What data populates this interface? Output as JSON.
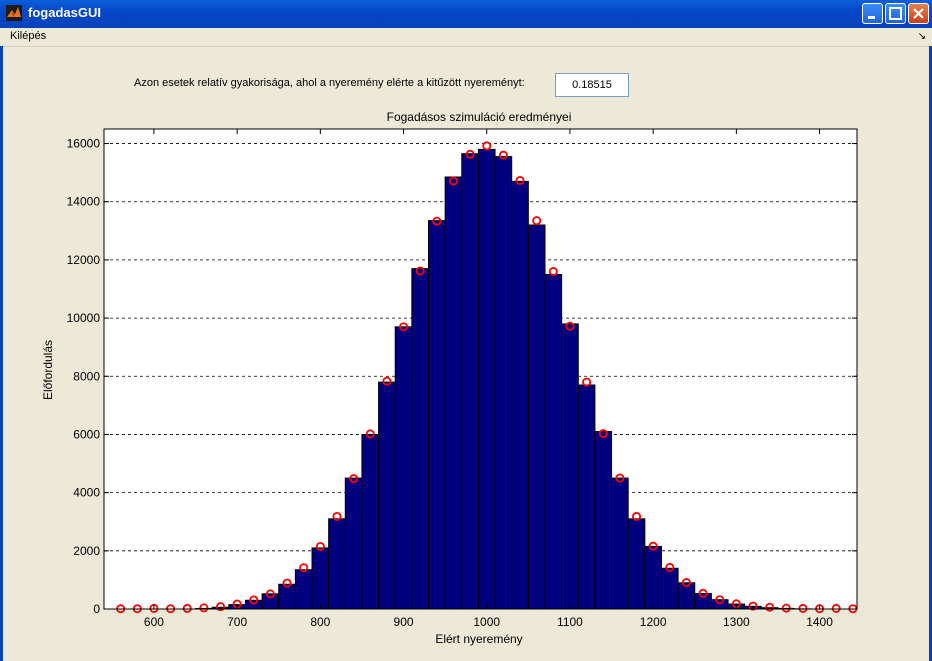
{
  "window": {
    "title": "fogadasGUI"
  },
  "menu": {
    "items": [
      "Kilépés"
    ]
  },
  "panel": {
    "label": "Azon esetek relatív gyakorisága, ahol a nyeremény elérte a kitűzött nyereményt:",
    "value": "0.18515"
  },
  "colors": {
    "bar_fill": "#00007f",
    "marker": "#ff0000",
    "background": "#ece9d8"
  },
  "chart_data": {
    "type": "bar",
    "title": "Fogadásos szimuláció eredményei",
    "xlabel": "Elért nyeremény",
    "ylabel": "Előfordulás",
    "xlim": [
      540,
      1445
    ],
    "ylim": [
      0,
      16500
    ],
    "grid": true,
    "x_ticks": [
      600,
      700,
      800,
      900,
      1000,
      1100,
      1200,
      1300,
      1400
    ],
    "y_ticks": [
      0,
      2000,
      4000,
      6000,
      8000,
      10000,
      12000,
      14000,
      16000
    ],
    "bar_width": 20,
    "x": [
      560,
      580,
      600,
      620,
      640,
      660,
      680,
      700,
      720,
      740,
      760,
      780,
      800,
      820,
      840,
      860,
      880,
      900,
      920,
      940,
      960,
      980,
      1000,
      1020,
      1040,
      1060,
      1080,
      1100,
      1120,
      1140,
      1160,
      1180,
      1200,
      1220,
      1240,
      1260,
      1280,
      1300,
      1320,
      1340,
      1360,
      1380,
      1400,
      1420,
      1440
    ],
    "series": [
      {
        "kind": "bar",
        "values": [
          0,
          0,
          0,
          0,
          0,
          20,
          60,
          150,
          300,
          520,
          850,
          1350,
          2100,
          3100,
          4500,
          6000,
          7800,
          9700,
          11700,
          13350,
          14850,
          15650,
          15800,
          15550,
          14700,
          13200,
          11500,
          9800,
          7700,
          6100,
          4500,
          3100,
          2150,
          1400,
          900,
          530,
          320,
          170,
          90,
          45,
          20,
          5,
          0,
          0,
          0
        ]
      },
      {
        "kind": "marker",
        "values": [
          10,
          10,
          20,
          10,
          20,
          40,
          80,
          170,
          310,
          520,
          890,
          1420,
          2150,
          3180,
          4480,
          6020,
          7830,
          9700,
          11620,
          13330,
          14710,
          15630,
          15920,
          15600,
          14730,
          13350,
          11600,
          9720,
          7800,
          6030,
          4500,
          3180,
          2160,
          1430,
          910,
          540,
          320,
          180,
          100,
          60,
          30,
          20,
          10,
          20,
          10
        ]
      }
    ]
  }
}
